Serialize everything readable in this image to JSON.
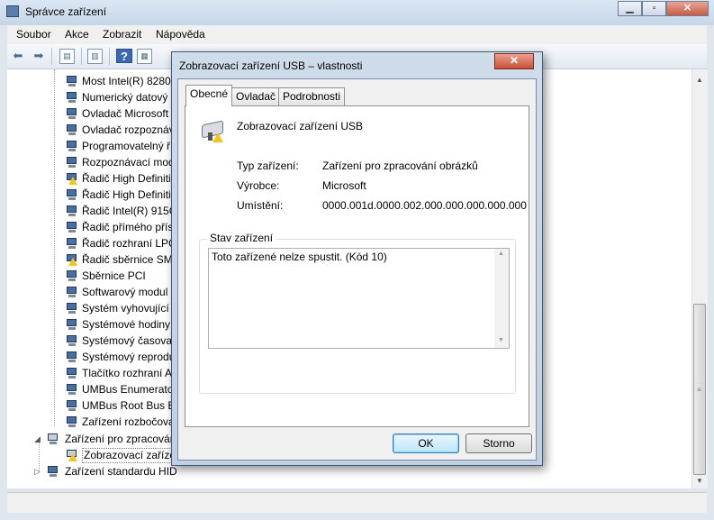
{
  "window": {
    "title": "Správce zařízení"
  },
  "menu": [
    "Soubor",
    "Akce",
    "Zobrazit",
    "Nápověda"
  ],
  "tree": {
    "children": [
      {
        "label": "Most Intel(R) 82801",
        "warn": false
      },
      {
        "label": "Numerický datový",
        "warn": false
      },
      {
        "label": "Ovladač Microsoft",
        "warn": false
      },
      {
        "label": "Ovladač rozpoznáv",
        "warn": false
      },
      {
        "label": "Programovatelný ř",
        "warn": false
      },
      {
        "label": "Rozpoznávací mod",
        "warn": false
      },
      {
        "label": "Řadič High Definiti",
        "warn": true
      },
      {
        "label": "Řadič High Definiti",
        "warn": false
      },
      {
        "label": "Řadič Intel(R) 915G",
        "warn": false
      },
      {
        "label": "Řadič přímého přís",
        "warn": false
      },
      {
        "label": "Řadič rozhraní LPC",
        "warn": false
      },
      {
        "label": "Řadič sběrnice SME",
        "warn": true
      },
      {
        "label": "Sběrnice PCI",
        "warn": false
      },
      {
        "label": "Softwarový modul",
        "warn": false
      },
      {
        "label": "Systém vyhovující",
        "warn": false
      },
      {
        "label": "Systémové hodiny",
        "warn": false
      },
      {
        "label": "Systémový časovač",
        "warn": false
      },
      {
        "label": "Systémový reprodu",
        "warn": false
      },
      {
        "label": "Tlačítko rozhraní A",
        "warn": false
      },
      {
        "label": "UMBus Enumerato",
        "warn": false
      },
      {
        "label": "UMBus Root Bus E",
        "warn": false
      },
      {
        "label": "Zařízení rozbočova",
        "warn": false
      }
    ],
    "imaging_category": "Zařízení pro zpracování",
    "imaging_child": "Zobrazovací zaříze",
    "hid_category": "Zařízení standardu HID"
  },
  "dialog": {
    "title": "Zobrazovací zařízení USB – vlastnosti",
    "close": "x",
    "tabs": [
      "Obecné",
      "Ovladač",
      "Podrobnosti"
    ],
    "device_name": "Zobrazovací zařízení USB",
    "type_label": "Typ zařízení:",
    "type_value": "Zařízení pro zpracování obrázků",
    "vendor_label": "Výrobce:",
    "vendor_value": "Microsoft",
    "location_label": "Umístění:",
    "location_value": "0000.001d.0000.002.000.000.000.000.000",
    "status_group": "Stav zařízení",
    "status_text": "Toto zařízené nelze spustit. (Kód 10)",
    "ok": "OK",
    "cancel": "Storno"
  },
  "icons": {
    "warning_color": "#f2c428",
    "accent": "#3c7fb1"
  }
}
